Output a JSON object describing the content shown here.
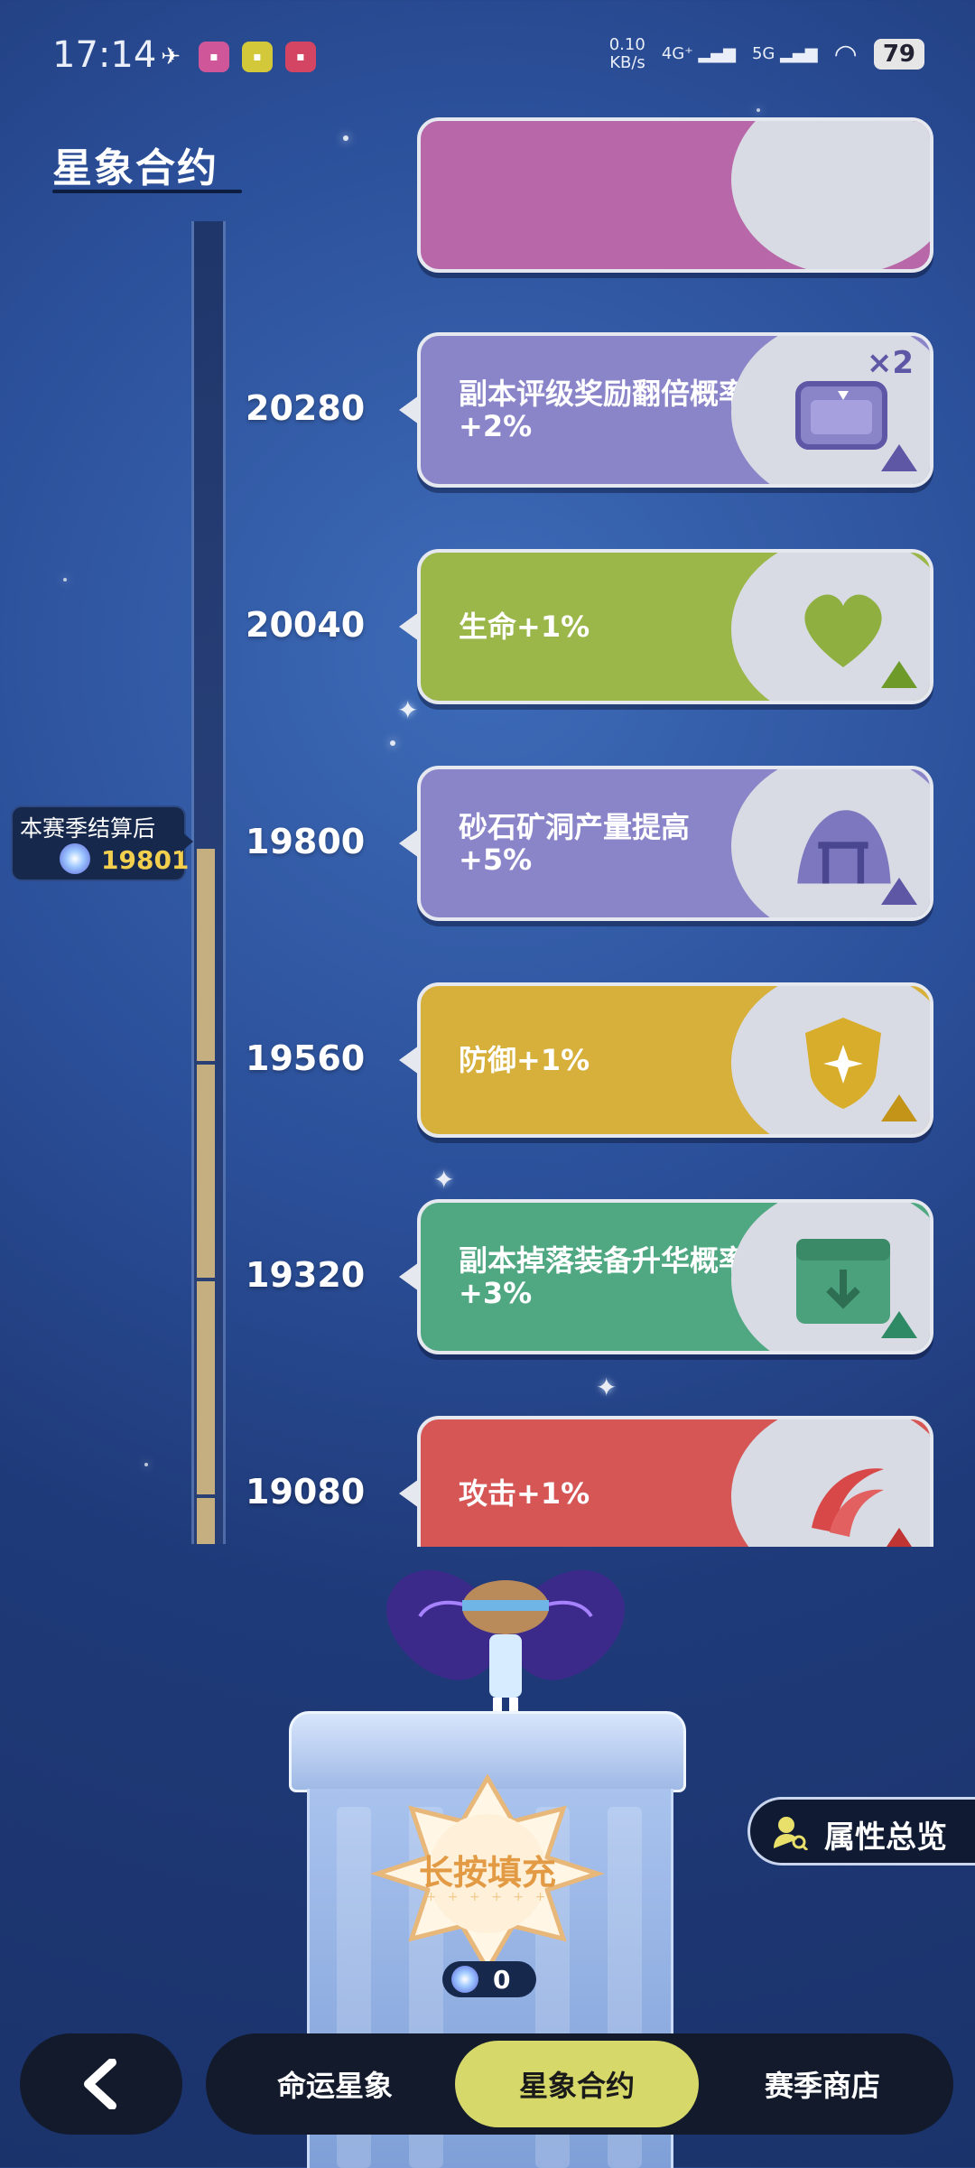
{
  "status_bar": {
    "time": "17:14",
    "net_speed_value": "0.10",
    "net_speed_unit": "KB/s",
    "signal_1": "4G⁺",
    "signal_2": "5G",
    "battery": "79"
  },
  "page_title": "星象合约",
  "season_marker": {
    "label": "本赛季结算后",
    "value": "19801"
  },
  "rewards": [
    {
      "threshold": "",
      "text": "",
      "color": "#b867a8"
    },
    {
      "threshold": "20280",
      "text": "副本评级奖励翻倍概率+2%",
      "color": "#8a84c9",
      "icon": "treasure-chest-icon",
      "badge": "×2"
    },
    {
      "threshold": "20040",
      "text": "生命+1%",
      "color": "#9bb74a",
      "icon": "heart-icon"
    },
    {
      "threshold": "19800",
      "text": "砂石矿洞产量提高+5%",
      "color": "#8a84c9",
      "icon": "mine-icon"
    },
    {
      "threshold": "19560",
      "text": "防御+1%",
      "color": "#d7b03c",
      "icon": "shield-icon"
    },
    {
      "threshold": "19320",
      "text": "副本掉落装备升华概率+3%",
      "color": "#4fa882",
      "icon": "box-icon"
    },
    {
      "threshold": "19080",
      "text": "攻击+1%",
      "color": "#d65656",
      "icon": "claw-icon"
    }
  ],
  "fill_button": {
    "label": "长按填充",
    "dots": "+ + + + + +"
  },
  "fill_count": "0",
  "attribute_overview": "属性总览",
  "tabs": [
    {
      "label": "命运星象",
      "active": false
    },
    {
      "label": "星象合约",
      "active": true
    },
    {
      "label": "赛季商店",
      "active": false
    }
  ],
  "colors": {
    "accent": "#d6d86a",
    "season_value": "#f2d04e",
    "fill_text": "#e29a44"
  }
}
